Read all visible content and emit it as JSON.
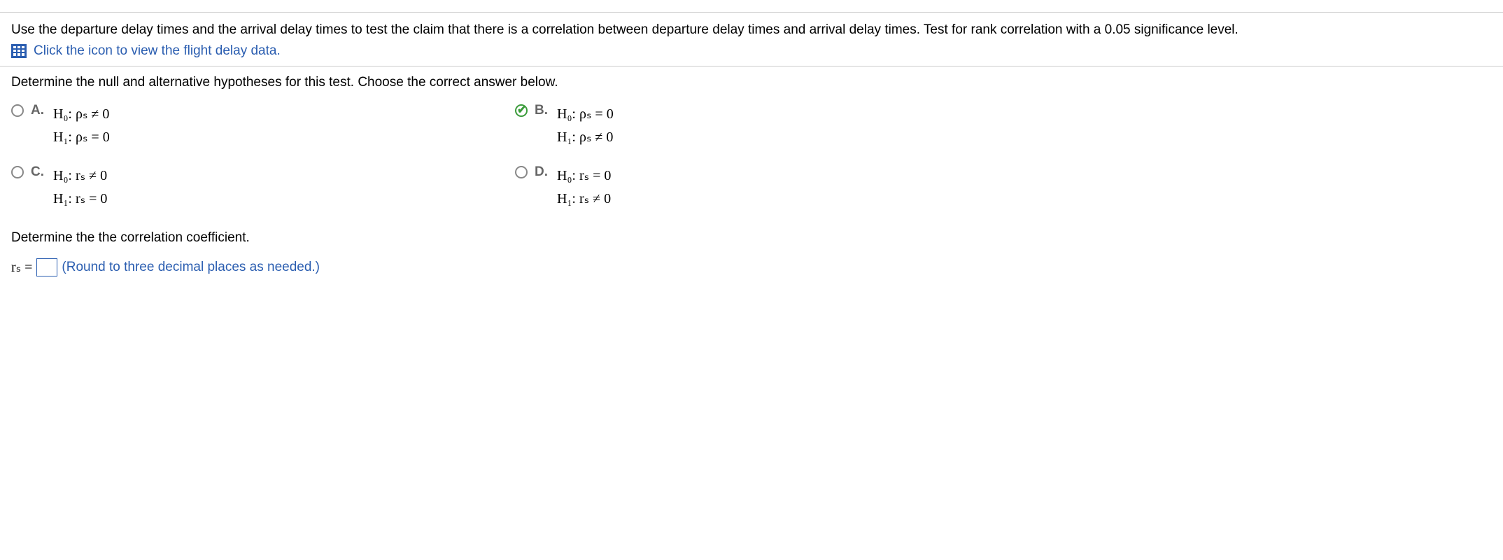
{
  "intro": {
    "line1": "Use the departure delay times and the arrival delay times to test the claim that there is a correlation between departure delay times and arrival delay times. Test for rank correlation with a 0.05 significance level.",
    "link": "Click the icon to view the flight delay data."
  },
  "question1": {
    "prompt": "Determine the null and alternative hypotheses for this test. Choose the correct answer below.",
    "options": {
      "a": {
        "label": "A.",
        "h0": "H₀: ρₛ ≠ 0",
        "h1": "H₁: ρₛ = 0"
      },
      "b": {
        "label": "B.",
        "h0": "H₀: ρₛ = 0",
        "h1": "H₁: ρₛ ≠ 0"
      },
      "c": {
        "label": "C.",
        "h0": "H₀: rₛ ≠ 0",
        "h1": "H₁: rₛ = 0"
      },
      "d": {
        "label": "D.",
        "h0": "H₀: rₛ = 0",
        "h1": "H₁: rₛ ≠ 0"
      }
    },
    "selected": "b"
  },
  "question2": {
    "prompt": "Determine the the correlation coefficient.",
    "var": "rₛ =",
    "hint": "(Round to three decimal places as needed.)"
  }
}
